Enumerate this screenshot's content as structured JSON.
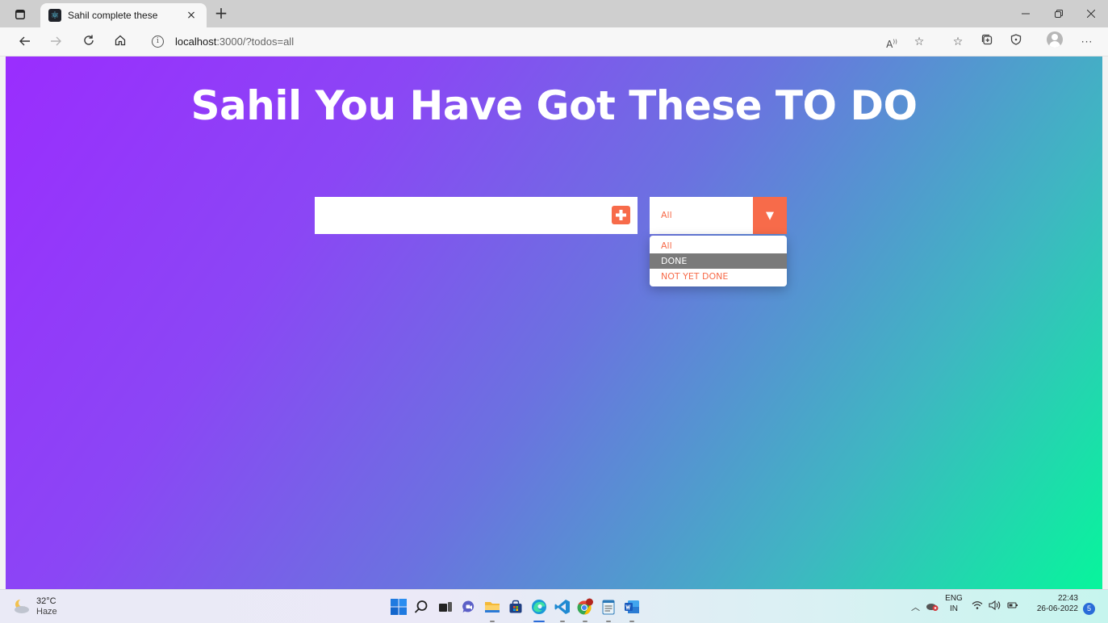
{
  "browser": {
    "tab_title": "Sahil complete these",
    "tab_close": "×",
    "new_tab": "+",
    "url_host": "localhost",
    "url_path": ":3000/?todos=all",
    "colors": {
      "tabbar": "#cfcfcf",
      "toolbar": "#f7f7f7"
    }
  },
  "page": {
    "title": "Sahil You Have Got These TO DO",
    "todo_input_value": "",
    "filter": {
      "selected": "All",
      "options": [
        "All",
        "DONE",
        "NOT YET DONE"
      ],
      "highlighted_index": 1
    },
    "colors": {
      "gradient_start": "#9a2dfe",
      "gradient_end": "#07f59c",
      "accent": "#f76b4a",
      "title_text": "#ffffff"
    }
  },
  "taskbar": {
    "weather_temp": "32°C",
    "weather_desc": "Haze",
    "apps": [
      "start-icon",
      "search-icon",
      "task-view-icon",
      "chat-icon",
      "file-explorer-icon",
      "store-icon",
      "edge-icon",
      "vscode-icon",
      "chrome-icon",
      "notepad-icon",
      "word-icon"
    ],
    "lang_top": "ENG",
    "lang_bottom": "IN",
    "time": "22:43",
    "date": "26-06-2022",
    "notification_count": "5"
  }
}
